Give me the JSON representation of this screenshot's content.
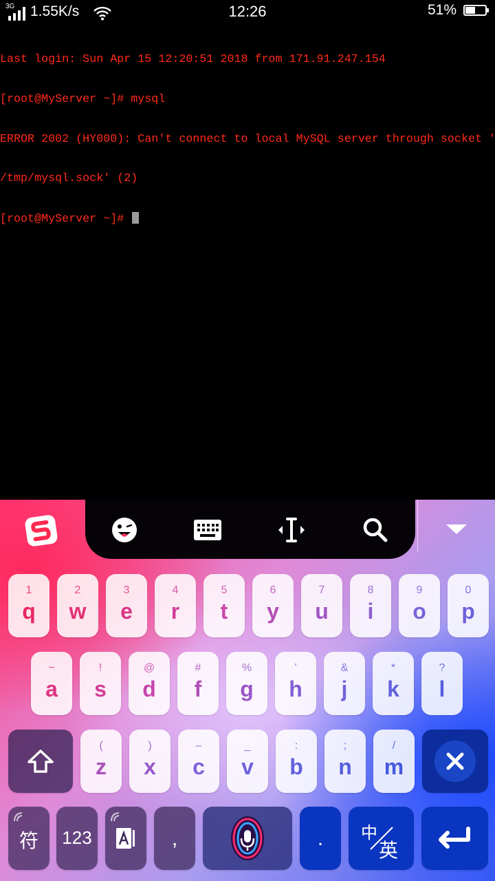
{
  "status_bar": {
    "network_type": "3G",
    "net_speed": "1.55K/s",
    "time": "12:26",
    "battery_percent": "51%",
    "battery_level": 0.51
  },
  "terminal": {
    "lines": [
      "Last login: Sun Apr 15 12:20:51 2018 from 171.91.247.154",
      "[root@MyServer ~]# mysql",
      "ERROR 2002 (HY000): Can't connect to local MySQL server through socket '",
      "/tmp/mysql.sock' (2)",
      "[root@MyServer ~]# "
    ],
    "text_color": "#ff2a1a"
  },
  "keyboard": {
    "toolbar_icons": [
      "sogou-logo-icon",
      "emoji-icon",
      "keyboard-icon",
      "cursor-move-icon",
      "search-icon",
      "collapse-keyboard-icon"
    ],
    "row1": [
      {
        "main": "q",
        "sub": "1"
      },
      {
        "main": "w",
        "sub": "2"
      },
      {
        "main": "e",
        "sub": "3"
      },
      {
        "main": "r",
        "sub": "4"
      },
      {
        "main": "t",
        "sub": "5"
      },
      {
        "main": "y",
        "sub": "6"
      },
      {
        "main": "u",
        "sub": "7"
      },
      {
        "main": "i",
        "sub": "8"
      },
      {
        "main": "o",
        "sub": "9"
      },
      {
        "main": "p",
        "sub": "0"
      }
    ],
    "row2": [
      {
        "main": "a",
        "sub": "~"
      },
      {
        "main": "s",
        "sub": "!"
      },
      {
        "main": "d",
        "sub": "@"
      },
      {
        "main": "f",
        "sub": "#"
      },
      {
        "main": "g",
        "sub": "%"
      },
      {
        "main": "h",
        "sub": "'"
      },
      {
        "main": "j",
        "sub": "&"
      },
      {
        "main": "k",
        "sub": "*"
      },
      {
        "main": "l",
        "sub": "?"
      }
    ],
    "row3": [
      {
        "main": "z",
        "sub": "("
      },
      {
        "main": "x",
        "sub": ")"
      },
      {
        "main": "c",
        "sub": "–"
      },
      {
        "main": "v",
        "sub": "_"
      },
      {
        "main": "b",
        "sub": ":"
      },
      {
        "main": "n",
        "sub": ";"
      },
      {
        "main": "m",
        "sub": "/"
      }
    ],
    "symbols_label": "符",
    "numbers_label": "123",
    "comma_label": ",",
    "period_label": ".",
    "lang_top": "中",
    "lang_bottom": "英"
  }
}
